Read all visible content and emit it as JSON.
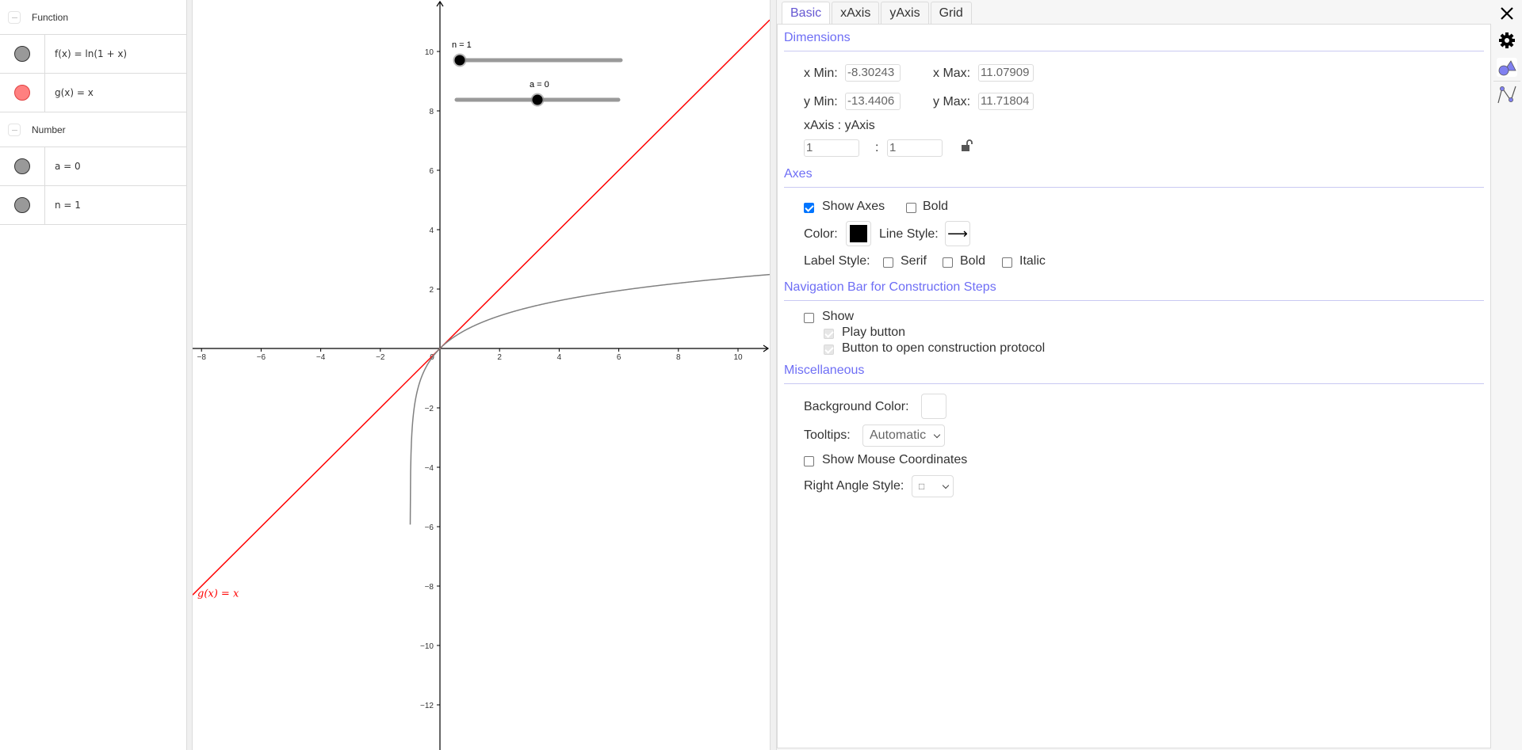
{
  "algebra": {
    "groups": [
      {
        "title": "Function",
        "items": [
          {
            "expr": "f(x) = ln(1 + x)",
            "color": "#999999"
          },
          {
            "expr": "g(x) = x",
            "color": "#ff8080"
          }
        ]
      },
      {
        "title": "Number",
        "items": [
          {
            "expr": "a = 0",
            "color": "#999999"
          },
          {
            "expr": "n = 1",
            "color": "#999999"
          }
        ]
      }
    ]
  },
  "graphics": {
    "x_tick_labels": [
      "−8",
      "−6",
      "−4",
      "−2",
      "0",
      "2",
      "4",
      "6",
      "8",
      "10"
    ],
    "y_tick_labels": [
      "10",
      "8",
      "6",
      "4",
      "2",
      "−2",
      "−4",
      "−6",
      "−8",
      "−10",
      "−12"
    ],
    "curve_label": "g(x) = x",
    "sliders": [
      {
        "name": "n",
        "label": "n = 1",
        "value": 1,
        "min": 1,
        "max": 10
      },
      {
        "name": "a",
        "label": "a = 0",
        "value": 0,
        "min": -5,
        "max": 5
      }
    ],
    "colors": {
      "f": "#808080",
      "g": "#ff0000",
      "axes": "#000000"
    }
  },
  "settings": {
    "tabs": [
      "Basic",
      "xAxis",
      "yAxis",
      "Grid"
    ],
    "active_tab": "Basic",
    "dimensions": {
      "title": "Dimensions",
      "x_min_label": "x Min:",
      "x_min": "-8.30243",
      "x_max_label": "x Max:",
      "x_max": "11.07909",
      "y_min_label": "y Min:",
      "y_min": "-13.4406",
      "y_max_label": "y Max:",
      "y_max": "11.71804",
      "ratio_label": "xAxis : yAxis",
      "ratio_x": "1",
      "ratio_sep": ":",
      "ratio_y": "1",
      "lock_icon": "unlocked-padlock"
    },
    "axes": {
      "title": "Axes",
      "show_axes_label": "Show Axes",
      "show_axes": true,
      "bold_label": "Bold",
      "bold": false,
      "color_label": "Color:",
      "color": "#000000",
      "line_style_label": "Line Style:",
      "line_style": "⟶",
      "label_style_label": "Label Style:",
      "serif_label": "Serif",
      "serif": false,
      "label_bold_label": "Bold",
      "label_bold": false,
      "italic_label": "Italic",
      "italic": false
    },
    "navigation": {
      "title": "Navigation Bar for Construction Steps",
      "show_label": "Show",
      "show": false,
      "play_label": "Play button",
      "play": true,
      "protocol_label": "Button to open construction protocol",
      "protocol": true
    },
    "misc": {
      "title": "Miscellaneous",
      "bg_color_label": "Background Color:",
      "bg_color": "#ffffff",
      "tooltips_label": "Tooltips:",
      "tooltips": "Automatic",
      "mouse_coords_label": "Show Mouse Coordinates",
      "mouse_coords": false,
      "right_angle_label": "Right Angle Style:",
      "right_angle": "□"
    }
  },
  "strip": {
    "close": "close-icon",
    "settings": "gear-icon",
    "graphics": "graphics-view-icon",
    "graphics2": "function-view-icon"
  }
}
